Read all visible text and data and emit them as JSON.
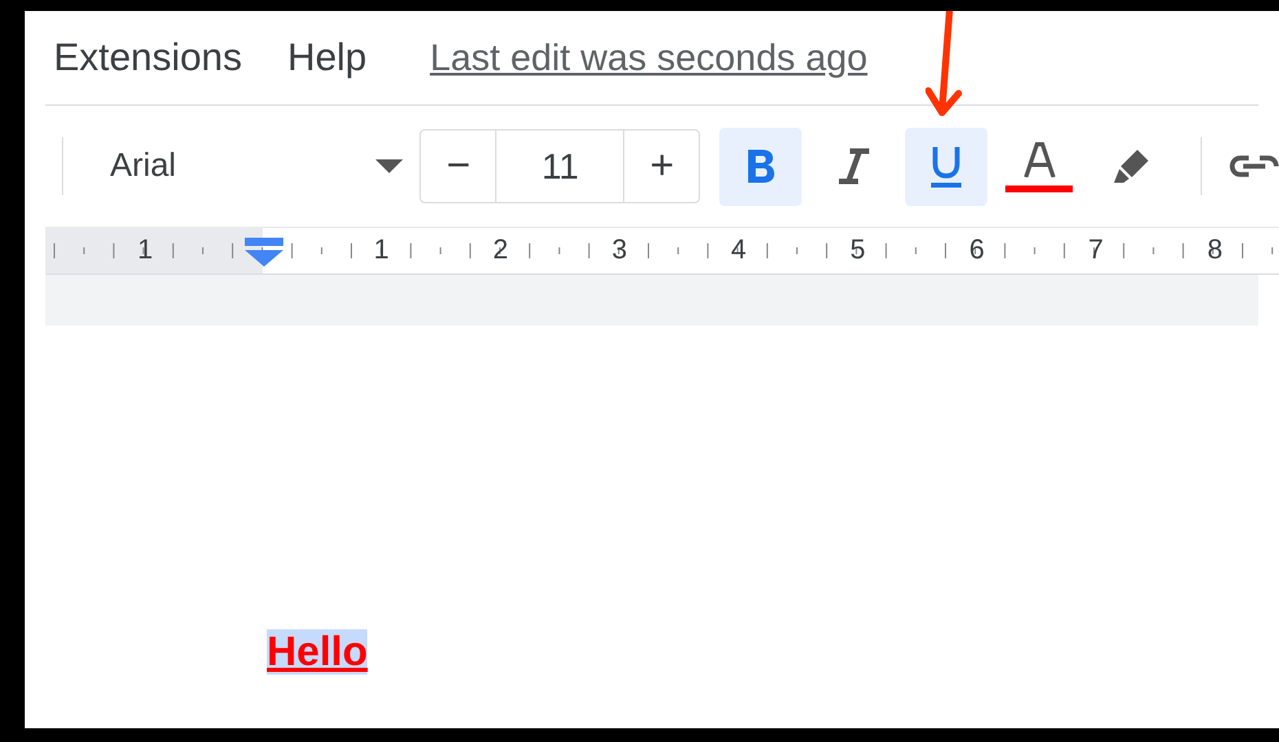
{
  "menu": [
    {
      "label": "Extensions"
    },
    {
      "label": "Help"
    }
  ],
  "last_edit": "Last edit was seconds ago",
  "toolbar": {
    "font": "Arial",
    "font_size": "11",
    "minus": "−",
    "plus": "+",
    "buttons": [
      {
        "kind": "bold",
        "selected": true
      },
      {
        "kind": "italic",
        "selected": false
      },
      {
        "kind": "underline",
        "selected": true
      },
      {
        "kind": "text-color",
        "selected": false,
        "color": "#ff0000"
      },
      {
        "kind": "highlight",
        "selected": false
      }
    ]
  },
  "ruler": {
    "labels": [
      "1",
      "1",
      "2",
      "3",
      "4",
      "5",
      "6",
      "7",
      "8"
    ]
  },
  "document": {
    "text": "Hello",
    "selected": true,
    "bold": true,
    "underline": true,
    "color": "#ff0000"
  }
}
